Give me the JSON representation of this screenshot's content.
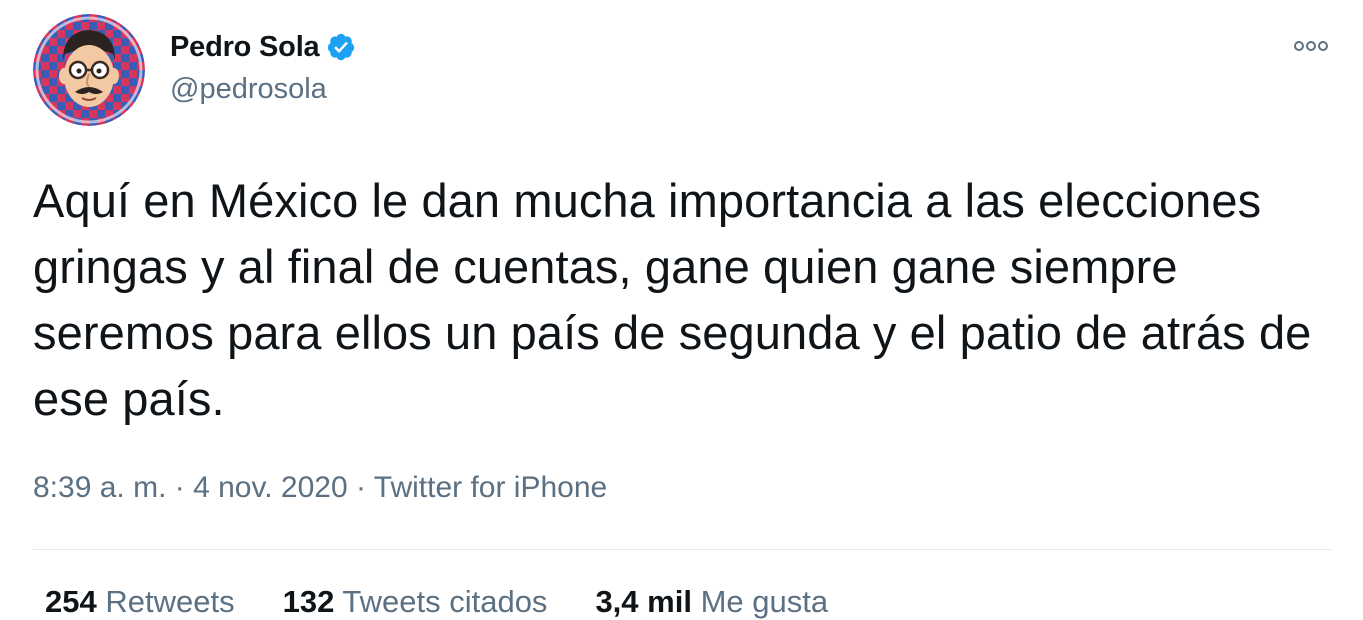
{
  "author": {
    "display_name": "Pedro Sola",
    "handle": "@pedrosola",
    "verified": true,
    "verified_icon": "verified-badge-icon"
  },
  "tweet": {
    "text": "Aquí en México le dan mucha importancia a las elecciones gringas y al final de cuentas, gane quien gane siempre seremos para ellos un país de segunda y el patio de atrás de ese país.",
    "time": "8:39 a. m.",
    "date": "4 nov. 2020",
    "separator": " · ",
    "source": "Twitter for iPhone"
  },
  "more_icon": "more-options-icon",
  "stats": {
    "retweets_count": "254",
    "retweets_label": "Retweets",
    "quotes_count": "132",
    "quotes_label": "Tweets citados",
    "likes_count": "3,4 mil",
    "likes_label": "Me gusta"
  },
  "colors": {
    "text": "#0f1419",
    "secondary": "#5b7083",
    "verified": "#1da1f2",
    "divider": "#e1e8ed"
  }
}
